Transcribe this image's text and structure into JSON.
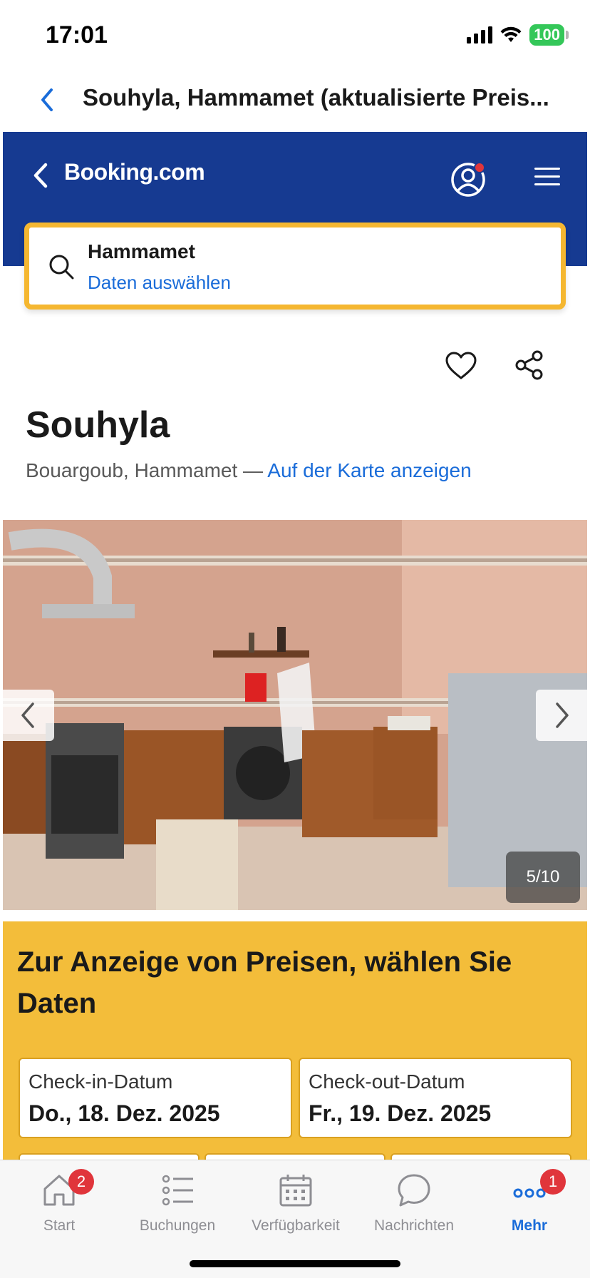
{
  "status_bar": {
    "time": "17:01",
    "battery": "100"
  },
  "browser": {
    "title": "Souhyla, Hammamet (aktualisierte Preis..."
  },
  "booking": {
    "logo": "Booking.com",
    "search": {
      "destination": "Hammamet",
      "dates": "Daten auswählen"
    }
  },
  "property": {
    "name": "Souhyla",
    "location": "Bouargoub, Hammamet",
    "separator": " — ",
    "map_link": "Auf der Karte anzeigen"
  },
  "gallery": {
    "counter": "5/10"
  },
  "dates_panel": {
    "title": "Zur Anzeige von Preisen, wählen Sie Daten",
    "checkin_label": "Check-in-Datum",
    "checkin_value": "Do., 18. Dez. 2025",
    "checkout_label": "Check-out-Datum",
    "checkout_value": "Fr., 19. Dez. 2025"
  },
  "tab_bar": {
    "tabs": [
      {
        "label": "Start",
        "icon": "home-icon",
        "badge": "2"
      },
      {
        "label": "Buchungen",
        "icon": "list-icon"
      },
      {
        "label": "Verfügbarkeit",
        "icon": "calendar-icon"
      },
      {
        "label": "Nachrichten",
        "icon": "chat-bubble-icon"
      },
      {
        "label": "Mehr",
        "icon": "more-icon",
        "badge": "1",
        "active": true
      }
    ]
  },
  "colors": {
    "brand_blue": "#163a91",
    "accent_yellow": "#f3bd3a",
    "link_blue": "#1a6cd9",
    "badge_red": "#e0353b"
  }
}
